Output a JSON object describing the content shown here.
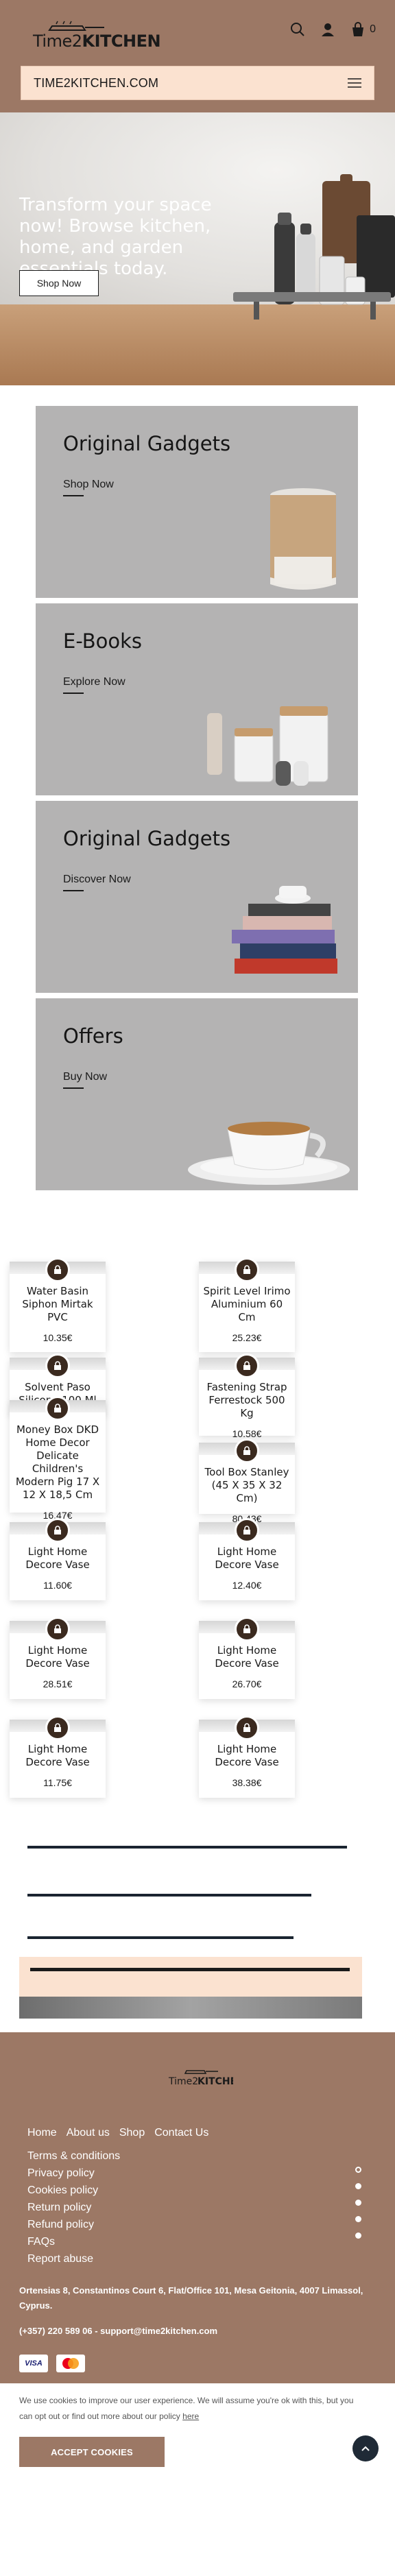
{
  "header": {
    "logo_brand_left": "Time2",
    "logo_brand_right": "KITCHEN",
    "cart_count": "0",
    "site_title": "TIME2KITCHEN.COM"
  },
  "hero": {
    "title": "Transform your space now! Browse kitchen, home, and garden essentials today.",
    "button": "Shop Now"
  },
  "categories": [
    {
      "title": "Original Gadgets",
      "cta": "Shop Now"
    },
    {
      "title": "E-Books",
      "cta": "Explore Now"
    },
    {
      "title": "Original Gadgets",
      "cta": "Discover Now"
    },
    {
      "title": "Offers",
      "cta": "Buy Now"
    }
  ],
  "products": [
    {
      "name": "Water Basin Siphon Mirtak PVC",
      "price": "10.35€"
    },
    {
      "name": "Spirit Level Irimo Aluminium 60 Cm",
      "price": "25.23€"
    },
    {
      "name": "Solvent Paso Silicone 100 Ml",
      "price": ""
    },
    {
      "name": "Fastening Strap Ferrestock 500 Kg",
      "price": "10.58€"
    },
    {
      "name": "Money Box DKD Home Decor Delicate Children's Modern Pig 17 X 12 X 18,5 Cm",
      "price": "16.47€"
    },
    {
      "name": "Tool Box Stanley (45 X 35 X 32 Cm)",
      "price": "80.43€"
    },
    {
      "name": "Light Home Decore Vase",
      "price": "11.60€"
    },
    {
      "name": "Light Home Decore Vase",
      "price": "12.40€"
    },
    {
      "name": "Light Home Decore Vase",
      "price": "28.51€"
    },
    {
      "name": "Light Home Decore Vase",
      "price": "26.70€"
    },
    {
      "name": "Light Home Decore Vase",
      "price": "11.75€"
    },
    {
      "name": "Light Home Decore Vase",
      "price": "38.38€"
    }
  ],
  "footer": {
    "nav": [
      "Home",
      "About us",
      "Shop",
      "Contact Us"
    ],
    "links": [
      "Terms & conditions",
      "Privacy policy",
      "Cookies policy",
      "Return policy",
      "Refund policy",
      "FAQs",
      "Report abuse"
    ],
    "address": "Ortensias 8, Constantinos Court 6, Flat/Office 101, Mesa Geitonia, 4007 Limassol, Cyprus.",
    "contact": "(+357) 220 589 06 - support@time2kitchen.com",
    "payments": [
      "VISA",
      "mastercard"
    ]
  },
  "cookie": {
    "text": "We use cookies to improve our user experience. We will assume you're ok with this, but you can opt out or find out more about our policy",
    "link": "here",
    "button": "ACCEPT COOKIES"
  },
  "colors": {
    "brand": "#9c7865",
    "accent": "#fbe2d0",
    "dark": "#3b2a1f"
  }
}
